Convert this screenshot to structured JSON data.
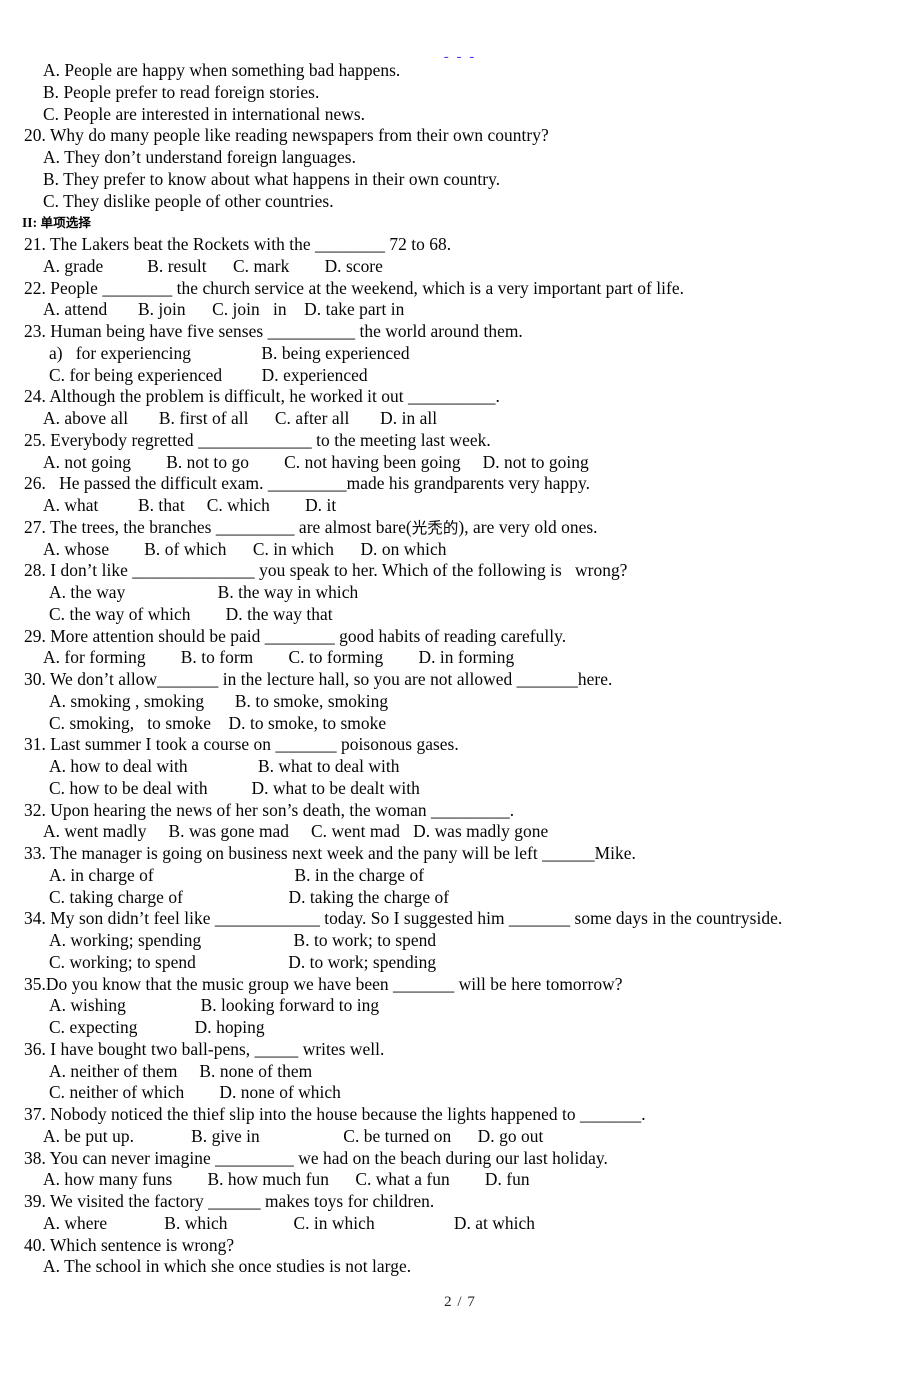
{
  "document": {
    "top_mark": "- - -",
    "footer_page": "2 / 7"
  },
  "reading_tail": {
    "options_19": [
      "A. People are happy when something bad happens.",
      "B. People prefer to read foreign stories.",
      "C. People are interested in international news."
    ],
    "question_20": "20. Why do many people like reading newspapers from their own country?",
    "options_20": [
      "A. They don’t understand foreign languages.",
      "B. They prefer to know about what happens in their own country.",
      "C. They dislike people of other countries."
    ]
  },
  "section": {
    "label": "II:",
    "title_cjk": "单项选择"
  },
  "questions": [
    {
      "stem": "21. The Lakers beat the Rockets with the ________ 72 to 68.",
      "option_lines": [
        "A. grade          B. result      C. mark        D. score"
      ]
    },
    {
      "stem": "22. People ________ the church service at the weekend, which is a very important part of life.",
      "option_lines": [
        "A. attend       B. join      C. join   in    D. take part in"
      ]
    },
    {
      "stem": "23. Human being have five senses __________ the world around them.",
      "option_lines": [
        "a)   for experiencing                B. being experienced",
        "C. for being experienced         D. experienced"
      ]
    },
    {
      "stem": "24. Although the problem is difficult, he worked it out __________.",
      "option_lines": [
        "A. above all       B. first of all      C. after all       D. in all"
      ]
    },
    {
      "stem": "25. Everybody regretted _____________ to the meeting last week.",
      "option_lines": [
        "A. not going        B. not to go        C. not having been going     D. not to going"
      ]
    },
    {
      "stem": "26.   He passed the difficult exam. _________made his grandparents very happy.",
      "option_lines": [
        "A. what         B. that     C. which        D. it"
      ]
    },
    {
      "stem": "27. The trees, the branches _________ are almost bare(光秃的), are very old ones.",
      "option_lines": [
        "A. whose        B. of which      C. in which      D. on which"
      ]
    },
    {
      "stem": "28. I don’t like ______________ you speak to her. Which of the following is   wrong?",
      "option_lines": [
        "A. the way                     B. the way in which",
        "C. the way of which        D. the way that"
      ]
    },
    {
      "stem": "29. More attention should be paid ________ good habits of reading carefully.",
      "option_lines": [
        "A. for forming        B. to form        C. to forming        D. in forming"
      ]
    },
    {
      "stem": "30. We don’t allow_______ in the lecture hall, so you are not allowed _______here.",
      "option_lines": [
        "A. smoking , smoking       B. to smoke, smoking",
        "C. smoking,   to smoke    D. to smoke, to smoke"
      ]
    },
    {
      "stem": "31. Last summer I took a course on _______ poisonous gases.",
      "option_lines": [
        "A. how to deal with                B. what to deal with",
        "C. how to be deal with          D. what to be dealt with"
      ]
    },
    {
      "stem": "32. Upon hearing the news of her son’s death, the woman _________.",
      "option_lines": [
        "A. went madly     B. was gone mad     C. went mad   D. was madly gone"
      ]
    },
    {
      "stem": "33. The manager is going on business next week and the pany will be left ______Mike.",
      "option_lines": [
        "A. in charge of                                B. in the charge of",
        "C. taking charge of                        D. taking the charge of"
      ]
    },
    {
      "stem": "34. My son didn’t feel like ____________ today. So I suggested him _______ some days in the countryside.",
      "option_lines": [
        "A. working; spending                     B. to work; to spend",
        "C. working; to spend                     D. to work; spending"
      ]
    },
    {
      "stem": "35.Do you know that the music group we have been _______ will be here tomorrow?",
      "option_lines": [
        "A. wishing                 B. looking forward to ing",
        "C. expecting             D. hoping"
      ]
    },
    {
      "stem": "36. I have bought two ball-pens, _____ writes well.",
      "option_lines": [
        "A. neither of them     B. none of them",
        "C. neither of which        D. none of which"
      ]
    },
    {
      "stem": "37. Nobody noticed the thief slip into the house because the lights happened to _______.",
      "option_lines": [
        "A. be put up.             B. give in                   C. be turned on      D. go out"
      ]
    },
    {
      "stem": "38. You can never imagine _________ we had on the beach during our last holiday.",
      "option_lines": [
        "A. how many funs        B. how much fun      C. what a fun        D. fun"
      ]
    },
    {
      "stem": "39. We visited the factory ______ makes toys for children.",
      "option_lines": [
        "A. where             B. which               C. in which                  D. at which"
      ]
    },
    {
      "stem": "40. Which sentence is wrong?",
      "option_lines": [
        "A. The school in which she once studies is not large."
      ]
    }
  ]
}
